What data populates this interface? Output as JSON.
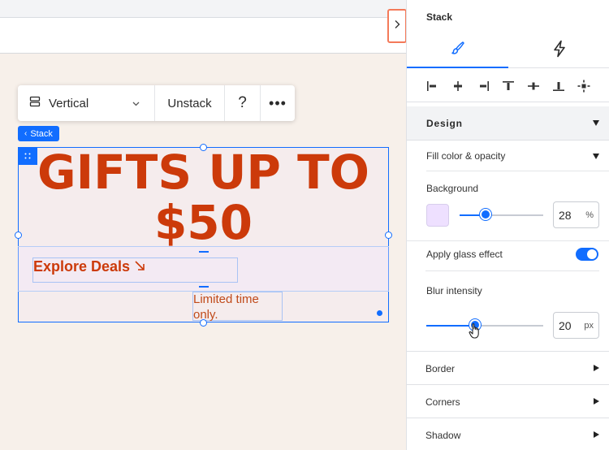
{
  "toolbar": {
    "layout_label": "Vertical",
    "unstack_label": "Unstack",
    "help_label": "?",
    "more_label": "•••"
  },
  "canvas": {
    "stack_tag": "Stack",
    "headline_line1": "GIFTS UP TO",
    "headline_line2": "$50",
    "deals_label": "Explore Deals",
    "limited_text": "Limited time only."
  },
  "panel": {
    "title": "Stack",
    "tabs": [
      {
        "name": "design",
        "icon": "brush-icon"
      },
      {
        "name": "interactions",
        "icon": "lightning-icon"
      }
    ],
    "design_section": "Design",
    "fill_section": "Fill color & opacity",
    "background_label": "Background",
    "background_color": "#eee0ff",
    "background_opacity": 28,
    "opacity_unit": "%",
    "glass_label": "Apply glass effect",
    "glass_enabled": true,
    "blur_label": "Blur intensity",
    "blur_value": 20,
    "blur_unit": "px",
    "border_label": "Border",
    "corners_label": "Corners",
    "shadow_label": "Shadow"
  },
  "colors": {
    "accent": "#116dff",
    "headline": "#cc3a0a",
    "highlight_border": "#f47a5a"
  }
}
